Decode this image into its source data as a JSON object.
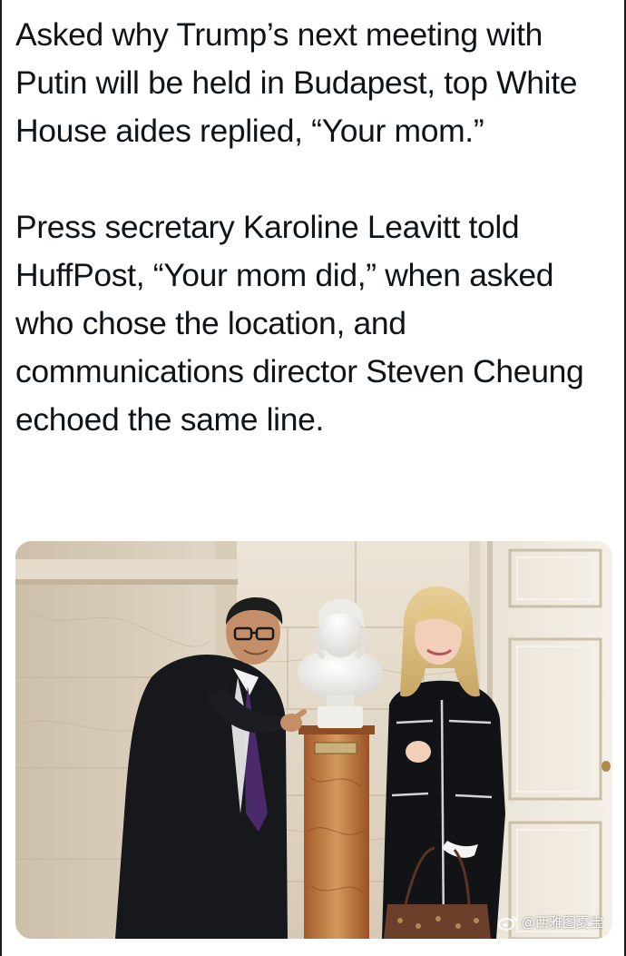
{
  "post": {
    "paragraph_1": "Asked why Trump’s next meeting with Putin will be held in Budapest, top White House aides replied, “Your mom.”",
    "paragraph_2": "Press secretary Karoline Leavitt told HuffPost, “Your mom did,” when asked who chose the location, and communications director Steven Cheung echoed the same line."
  },
  "photo": {
    "subject": "Two people posing beside a white marble bust on a marble pedestal in a marble-walled room"
  },
  "watermark": {
    "handle": "@西雅图夏宝",
    "icon": "weibo-icon"
  }
}
